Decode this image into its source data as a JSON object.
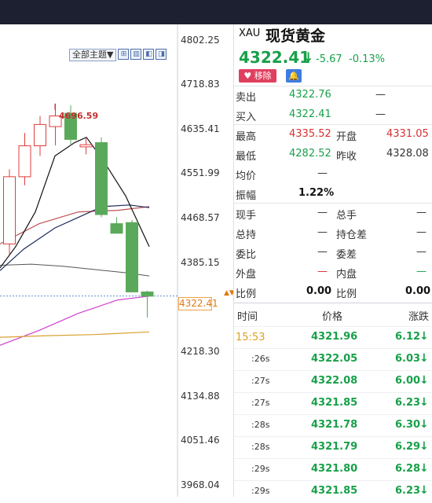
{
  "toolbar": {
    "theme_label": "全部主题▼",
    "icons": [
      "grid-icon",
      "layout-icon",
      "prev-icon",
      "next-icon"
    ]
  },
  "chart": {
    "axis_labels": [
      "4802.25",
      "4718.83",
      "4635.41",
      "4551.99",
      "4468.57",
      "4385.15",
      "4218.30",
      "4134.88",
      "4051.46",
      "3968.04"
    ],
    "current_price_tag": "4322.41",
    "high_marker": "4696.59",
    "candles": [
      {
        "open": 4420,
        "high": 4560,
        "low": 4400,
        "close": 4546
      },
      {
        "open": 4546,
        "high": 4628,
        "low": 4530,
        "close": 4604
      },
      {
        "open": 4604,
        "high": 4660,
        "low": 4585,
        "close": 4644
      },
      {
        "open": 4640,
        "high": 4683,
        "low": 4605,
        "close": 4660
      },
      {
        "open": 4665,
        "high": 4680,
        "low": 4605,
        "close": 4616
      },
      {
        "open": 4602,
        "high": 4618,
        "low": 4588,
        "close": 4606
      },
      {
        "open": 4610,
        "high": 4620,
        "low": 4470,
        "close": 4475
      },
      {
        "open": 4458,
        "high": 4470,
        "low": 4440,
        "close": 4440
      },
      {
        "open": 4460,
        "high": 4465,
        "low": 4330,
        "close": 4330
      },
      {
        "open": 4330,
        "high": 4332,
        "low": 4282,
        "close": 4322
      }
    ],
    "colors": {
      "up": "#e03c3c",
      "down": "#5aa95a",
      "ma5": "#111111",
      "ma10": "#1d2a5a",
      "ma20": "#c05050",
      "ma60": "#d040d0",
      "ma120": "#d9a030",
      "gray": "#555555"
    }
  },
  "quote": {
    "symbol": "XAU",
    "name": "现货黄金",
    "price": "4322.41",
    "change": "-5.67",
    "change_pct": "-0.13%",
    "remove_label": "移除",
    "sell_label": "卖出",
    "sell": "4322.76",
    "sell_vol": "—",
    "buy_label": "买入",
    "buy": "4322.41",
    "buy_vol": "—",
    "high_label": "最高",
    "high": "4335.52",
    "open_label": "开盘",
    "open": "4331.05",
    "low_label": "最低",
    "low": "4282.52",
    "prev_label": "昨收",
    "prev": "4328.08",
    "avg_label": "均价",
    "avg": "—",
    "amp_label": "振幅",
    "amp": "1.22%",
    "cur_hand_label": "现手",
    "cur_hand": "—",
    "total_hand_label": "总手",
    "total_hand": "—",
    "total_hold_label": "总持",
    "total_hold": "—",
    "hold_diff_label": "持仓差",
    "hold_diff": "—",
    "weibi_label": "委比",
    "weibi": "—",
    "weicha_label": "委差",
    "weicha": "—",
    "outer_label": "外盘",
    "outer": "—",
    "inner_label": "内盘",
    "inner": "—",
    "ratio1_label": "比例",
    "ratio1": "0.00",
    "ratio2_label": "比例",
    "ratio2": "0.00"
  },
  "ticks": {
    "headers": [
      "时间",
      "价格",
      "涨跌"
    ],
    "rows": [
      {
        "time": "15:53",
        "price": "4321.96",
        "chg": "6.12"
      },
      {
        "time": ":26s",
        "price": "4322.05",
        "chg": "6.03"
      },
      {
        "time": ":27s",
        "price": "4322.08",
        "chg": "6.00"
      },
      {
        "time": ":27s",
        "price": "4321.85",
        "chg": "6.23"
      },
      {
        "time": ":28s",
        "price": "4321.78",
        "chg": "6.30"
      },
      {
        "time": ":28s",
        "price": "4321.79",
        "chg": "6.29"
      },
      {
        "time": ":29s",
        "price": "4321.80",
        "chg": "6.28"
      },
      {
        "time": ":29s",
        "price": "4321.85",
        "chg": "6.23"
      }
    ]
  }
}
